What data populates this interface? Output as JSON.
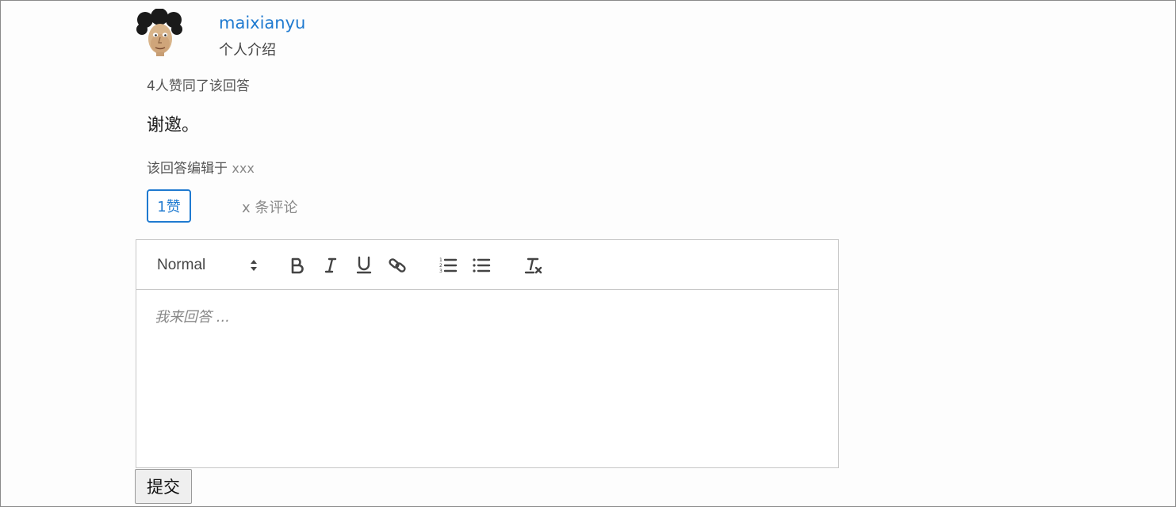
{
  "answer": {
    "author": {
      "username": "maixianyu",
      "bio": "个人介绍",
      "avatar_icon": "cartoon-face-avatar"
    },
    "likes_summary": "4人赞同了该回答",
    "content": "谢邀。",
    "edit_info": {
      "label": "该回答编辑于",
      "time": "xxx"
    },
    "like_button_label": "1赞",
    "comments_label": "x 条评论"
  },
  "editor": {
    "format_selected": "Normal",
    "toolbar_icons": [
      "bold-icon",
      "italic-icon",
      "underline-icon",
      "link-icon",
      "ordered-list-icon",
      "bullet-list-icon",
      "clear-format-icon"
    ],
    "placeholder": "我来回答 ..."
  },
  "submit_label": "提交",
  "colors": {
    "accent": "#1f7ad0",
    "border": "#c8c8c8",
    "icon": "#444444"
  }
}
